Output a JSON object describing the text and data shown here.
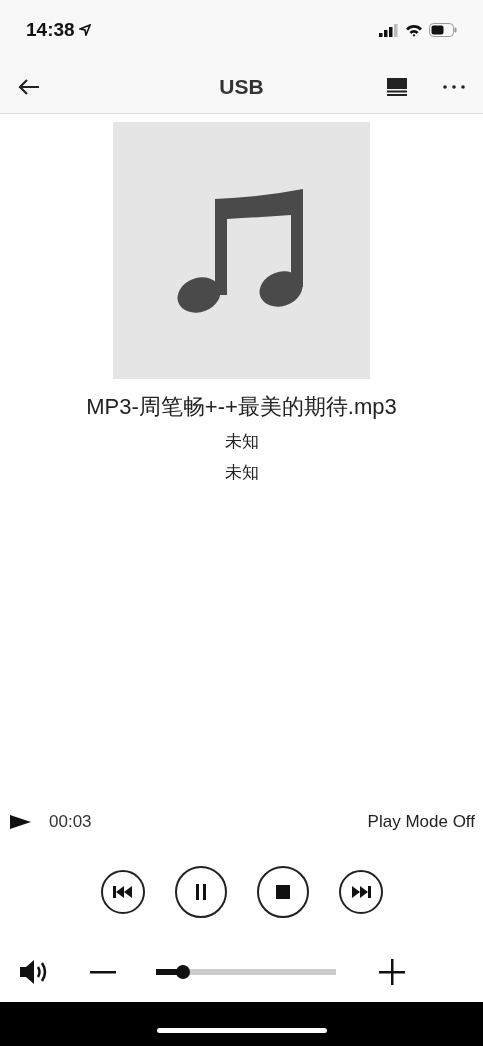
{
  "status_bar": {
    "time": "14:38"
  },
  "nav": {
    "title": "USB"
  },
  "track": {
    "title": "MP3-周笔畅+-+最美的期待.mp3",
    "artist": "未知",
    "album": "未知"
  },
  "progress": {
    "position": "00:03",
    "play_mode": "Play Mode Off"
  },
  "volume": {
    "level": 0.15
  }
}
